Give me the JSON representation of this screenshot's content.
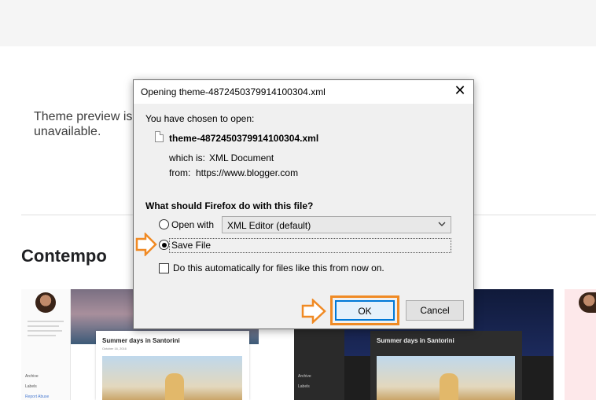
{
  "background": {
    "preview_message": "Theme preview is unavailable.",
    "section_title": "Contempo",
    "thumbnails": {
      "light_post_title": "Summer days in Santorini",
      "light_post_date": "October 16, 2016",
      "dark_post_title": "Summer days in Santorini",
      "sidebar_items": [
        "Archive",
        "Labels",
        "Report Abuse"
      ]
    }
  },
  "dialog": {
    "title": "Opening theme-4872450379914100304.xml",
    "close_glyph": "✕",
    "chosen_label": "You have chosen to open:",
    "file_name": "theme-4872450379914100304.xml",
    "which_is_label": "which is:",
    "which_is_value": "XML Document",
    "from_label": "from:",
    "from_value": "https://www.blogger.com",
    "question": "What should Firefox do with this file?",
    "open_with_label": "Open with",
    "open_with_selected": "XML Editor (default)",
    "save_file_label": "Save File",
    "auto_label": "Do this automatically for files like this from now on.",
    "ok_label": "OK",
    "cancel_label": "Cancel",
    "selected_option": "save_file",
    "auto_checked": false
  },
  "annotations": {
    "highlight_color": "#f08a24"
  }
}
